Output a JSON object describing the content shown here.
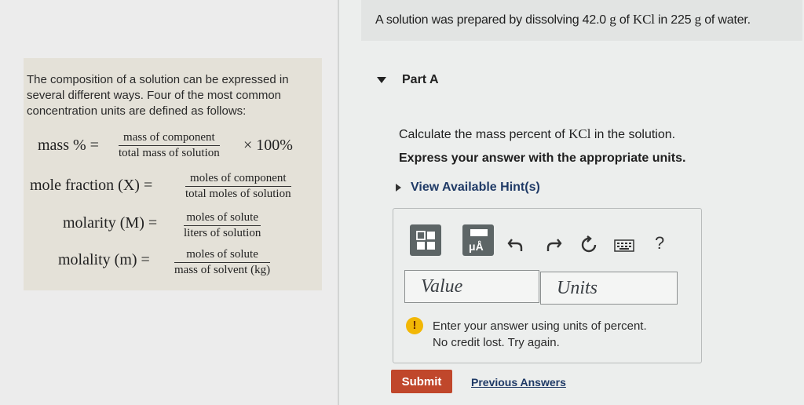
{
  "problem": {
    "before": "A solution was prepared by dissolving 42.0 ",
    "unit1": "g",
    "of": " of ",
    "compound": "KCl",
    "middle": " in 225 ",
    "unit2": "g",
    "after": " of water."
  },
  "info": {
    "intro": "The composition of a solution can be expressed in several different ways. Four of the most common concentration units are defined as follows:",
    "formulas": [
      {
        "lhs": "mass % =",
        "numerator": "mass of component",
        "denominator": "total mass of solution",
        "suffix": "× 100%"
      },
      {
        "lhs": "mole fraction (X) =",
        "numerator": "moles of component",
        "denominator": "total moles of solution"
      },
      {
        "lhs": "molarity (M) =",
        "numerator": "moles of solute",
        "denominator": "liters of solution"
      },
      {
        "lhs": "molality (m) =",
        "numerator": "moles of solute",
        "denominator": "mass of solvent (kg)"
      }
    ]
  },
  "part": {
    "title": "Part A",
    "question_before": "Calculate the mass percent of ",
    "question_compound": "KCl",
    "question_after": " in the solution.",
    "instruction": "Express your answer with the appropriate units.",
    "hint_link": "View Available Hint(s)"
  },
  "toolbar": {
    "units_button_label": "μÅ",
    "help_label": "?"
  },
  "answer": {
    "value_placeholder": "Value",
    "units_placeholder": "Units"
  },
  "feedback": {
    "line1": "Enter your answer using units of percent.",
    "line2": "No credit lost. Try again."
  },
  "actions": {
    "submit_label": "Submit",
    "previous_answers_label": "Previous Answers"
  }
}
